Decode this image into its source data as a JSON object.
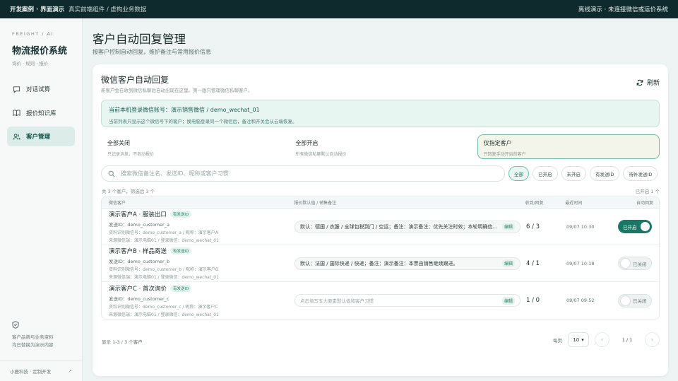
{
  "topbar": {
    "brand": "开发案例 · 界面演示",
    "subtitle": "真实前端组件 / 虚构业务数据",
    "status": "离线演示 · 未连接微信或运价系统"
  },
  "sidebar": {
    "kicker": "FREIGHT / AI",
    "title": "物流报价系统",
    "tagline": "询价 · 规则 · 报价",
    "nav": [
      {
        "label": "对话试算",
        "icon": "chat-icon"
      },
      {
        "label": "报价知识库",
        "icon": "book-icon"
      },
      {
        "label": "客户管理",
        "icon": "users-icon",
        "active": true
      }
    ],
    "footer_note_line1": "客户品牌与业务资料",
    "footer_note_line2": "均已替换为演示内容",
    "bottom_label": "小鹿科技 · 定制开发",
    "bottom_arrow": "↗"
  },
  "page": {
    "title": "客户自动回复管理",
    "subtitle": "按客户控制自动回复，维护备注与常用报价信息"
  },
  "card": {
    "title": "微信客户自动回复",
    "subtitle": "新客户会在收到微信私聊后自动出现在这里。第一版只管理微信私聊客户。",
    "refresh_label": "刷新",
    "account_line": "当前本机登录微信账号：演示销售微信 / demo_wechat_01",
    "account_hint": "当前列表只显示这个微信号下的客户；换电脑登录同一个微信后，备注和开关会从云端恢复。"
  },
  "modes": [
    {
      "title": "全部关闭",
      "desc": "只记录消息，不自动报价"
    },
    {
      "title": "全部开启",
      "desc": "所有微信私聊默认自动报价"
    },
    {
      "title": "仅指定客户",
      "desc": "只回复手动开启的客户",
      "active": true
    }
  ],
  "search": {
    "placeholder": "搜索微信备注名、发送ID、昵称或客户习惯"
  },
  "filters": [
    {
      "label": "全部",
      "active": true
    },
    {
      "label": "已开启"
    },
    {
      "label": "未开启"
    },
    {
      "label": "有发送ID"
    },
    {
      "label": "待补发送ID"
    }
  ],
  "counts": {
    "left": "共 3 个客户，筛选后 3 个",
    "right": "已开启 1 个"
  },
  "table": {
    "headers": [
      "微信客户",
      "报价默认值 / 销售备注",
      "收到/回复",
      "最近时间",
      "自动回复"
    ],
    "rows": [
      {
        "name": "演示客户A · 服装出口",
        "badge": "有发送ID",
        "sender": "发送ID：demo_customer_a",
        "source": "资料识别微信号：demo_customer_a / 昵称：演示客户A",
        "login": "来源微信端：演示电脑01 / 登录微信：demo_wechat_01",
        "note": "默认：德国 / 衣服 / 全球包税到门 / 空运；备注：演示备注：优先关注时效；本轮明确信息...",
        "edit": "编辑",
        "counts": "6 / 3",
        "time": "09/07 10:30",
        "toggle_label": "已开启",
        "enabled": true
      },
      {
        "name": "演示客户B · 样品寄送",
        "badge": "有发送ID",
        "sender": "发送ID：demo_customer_b",
        "source": "资料识别微信号：demo_customer_b / 昵称：演示客户B",
        "login": "来源微信端：演示电脑01 / 登录微信：demo_wechat_01",
        "note": "默认：法国 / 国际快递 / 快递；备注：演示备注：本票由销售继续跟进。",
        "edit": "编辑",
        "counts": "4 / 1",
        "time": "09/07 10:18",
        "toggle_label": "已关闭",
        "enabled": false
      },
      {
        "name": "演示客户C · 首次询价",
        "badge": "有发送ID",
        "sender": "发送ID：demo_customer_c",
        "source": "资料识别微信号：demo_customer_c / 昵称：演示客户C",
        "login": "来源微信端：演示电脑01 / 登录微信：demo_wechat_01",
        "note": "点击填写五大要素默认值和客户习惯",
        "edit": "编辑",
        "counts": "1 / 0",
        "time": "09/07 09:52",
        "toggle_label": "已关闭",
        "enabled": false
      }
    ]
  },
  "pager": {
    "summary": "显示 1-3 / 3 个客户",
    "per_page_label": "每页",
    "per_page": "10",
    "page": "1 / 1",
    "prev": "‹",
    "next": "›"
  },
  "colors": {
    "topbar": "#0f2a2c",
    "accent": "#1a7765",
    "accent_light": "#e8f6f2"
  }
}
